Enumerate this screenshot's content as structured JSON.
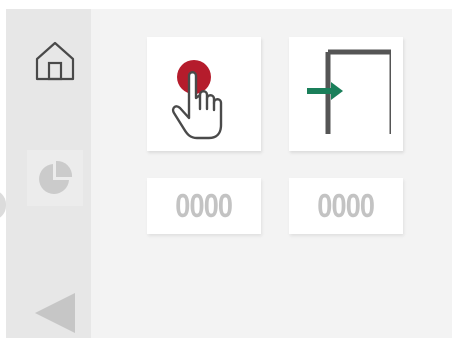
{
  "sidebar": {
    "items": [
      {
        "icon": "home-icon"
      },
      {
        "icon": "pie-chart-icon"
      },
      {
        "icon": "back-arrow-icon"
      }
    ]
  },
  "tiles": [
    {
      "icon": "touch-hand-icon",
      "counter": "0000"
    },
    {
      "icon": "door-enter-icon",
      "counter": "0000"
    }
  ],
  "colors": {
    "touch_dot": "#b51c2c",
    "arrow_green": "#1a7f5a",
    "door_gray": "#555555",
    "sidebar_icon": "#4a4a4a",
    "inactive_icon": "#c6c6c6",
    "counter_text": "#c3c3c3"
  }
}
